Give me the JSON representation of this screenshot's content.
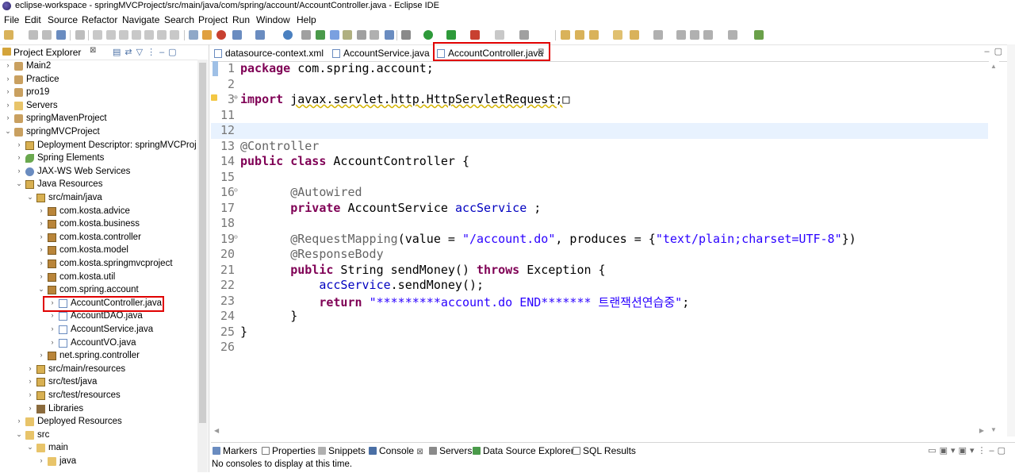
{
  "window": {
    "title": "eclipse-workspace - springMVCProject/src/main/java/com/spring/account/AccountController.java - Eclipse IDE"
  },
  "menu": [
    "File",
    "Edit",
    "Source",
    "Refactor",
    "Navigate",
    "Search",
    "Project",
    "Run",
    "Window",
    "Help"
  ],
  "explorer": {
    "title": "Project Explorer",
    "close": "⊠",
    "tree": [
      {
        "label": "Main2",
        "arrow": "›",
        "icon": "project"
      },
      {
        "label": "Practice",
        "arrow": "›",
        "icon": "project"
      },
      {
        "label": "pro19",
        "arrow": "›",
        "icon": "project"
      },
      {
        "label": "Servers",
        "arrow": "›",
        "icon": "folder"
      },
      {
        "label": "springMavenProject",
        "arrow": "›",
        "icon": "project"
      },
      {
        "label": "springMVCProject",
        "arrow": "⌄",
        "icon": "project"
      },
      {
        "label": "Deployment Descriptor: springMVCProject",
        "arrow": "›",
        "icon": "source"
      },
      {
        "label": "Spring Elements",
        "arrow": "›",
        "icon": "leaf"
      },
      {
        "label": "JAX-WS Web Services",
        "arrow": "›",
        "icon": "ws"
      },
      {
        "label": "Java Resources",
        "arrow": "⌄",
        "icon": "source"
      },
      {
        "label": "src/main/java",
        "arrow": "⌄",
        "icon": "source"
      },
      {
        "label": "com.kosta.advice",
        "arrow": "›",
        "icon": "package"
      },
      {
        "label": "com.kosta.business",
        "arrow": "›",
        "icon": "package"
      },
      {
        "label": "com.kosta.controller",
        "arrow": "›",
        "icon": "package"
      },
      {
        "label": "com.kosta.model",
        "arrow": "›",
        "icon": "package"
      },
      {
        "label": "com.kosta.springmvcproject",
        "arrow": "›",
        "icon": "package"
      },
      {
        "label": "com.kosta.util",
        "arrow": "›",
        "icon": "package"
      },
      {
        "label": "com.spring.account",
        "arrow": "⌄",
        "icon": "package"
      },
      {
        "label": "AccountController.java",
        "arrow": "›",
        "icon": "java"
      },
      {
        "label": "AccountDAO.java",
        "arrow": "›",
        "icon": "java"
      },
      {
        "label": "AccountService.java",
        "arrow": "›",
        "icon": "java"
      },
      {
        "label": "AccountVO.java",
        "arrow": "›",
        "icon": "java"
      },
      {
        "label": "net.spring.controller",
        "arrow": "›",
        "icon": "package"
      },
      {
        "label": "src/main/resources",
        "arrow": "›",
        "icon": "source"
      },
      {
        "label": "src/test/java",
        "arrow": "›",
        "icon": "source"
      },
      {
        "label": "src/test/resources",
        "arrow": "›",
        "icon": "source"
      },
      {
        "label": "Libraries",
        "arrow": "›",
        "icon": "lib"
      },
      {
        "label": "Deployed Resources",
        "arrow": "›",
        "icon": "folder"
      },
      {
        "label": "src",
        "arrow": "⌄",
        "icon": "folder"
      },
      {
        "label": "main",
        "arrow": "⌄",
        "icon": "folder"
      },
      {
        "label": "java",
        "arrow": "›",
        "icon": "folder"
      }
    ]
  },
  "editor": {
    "tabs": [
      {
        "label": "datasource-context.xml"
      },
      {
        "label": "AccountService.java"
      },
      {
        "label": "AccountController.java",
        "close": "⊠"
      }
    ],
    "lines": [
      {
        "no": "1",
        "html": "<span class='kw'>package</span> com.spring.account;"
      },
      {
        "no": "2",
        "html": ""
      },
      {
        "no": "3",
        "html": "<span class='kw'>import</span> <u style='text-decoration-style:wavy;text-decoration-color:#d4b400'>javax.servlet.http.HttpServletRequest;</u>&#9633;"
      },
      {
        "no": "11",
        "html": ""
      },
      {
        "no": "12",
        "html": ""
      },
      {
        "no": "13",
        "html": "<span class='ann'>@Controller</span>"
      },
      {
        "no": "14",
        "html": "<span class='kw'>public</span> <span class='kw'>class</span> AccountController {"
      },
      {
        "no": "15",
        "html": ""
      },
      {
        "no": "16",
        "html": "       <span class='ann'>@Autowired</span>"
      },
      {
        "no": "17",
        "html": "       <span class='kw'>private</span> AccountService <span class='fld'>accService</span> ;"
      },
      {
        "no": "18",
        "html": ""
      },
      {
        "no": "19",
        "html": "       <span class='ann'>@RequestMapping</span>(value = <span class='str'>\"/account.do\"</span>, produces = {<span class='str'>\"text/plain;charset=UTF-8\"</span>})"
      },
      {
        "no": "20",
        "html": "       <span class='ann'>@ResponseBody</span>"
      },
      {
        "no": "21",
        "html": "       <span class='kw'>public</span> String sendMoney() <span class='kw'>throws</span> Exception {"
      },
      {
        "no": "22",
        "html": "           <span class='fld'>accService</span>.sendMoney();"
      },
      {
        "no": "23",
        "html": "           <span class='kw'>return</span> <span class='str'>\"*********account.do END******* 트랜잭션연습중\"</span>;"
      },
      {
        "no": "24",
        "html": "       }"
      },
      {
        "no": "25",
        "html": "}"
      },
      {
        "no": "26",
        "html": ""
      }
    ]
  },
  "bottom": {
    "tabs": [
      "Markers",
      "Properties",
      "Snippets",
      "Console",
      "Servers",
      "Data Source Explorer",
      "SQL Results"
    ],
    "close": "⊠",
    "message": "No consoles to display at this time."
  }
}
